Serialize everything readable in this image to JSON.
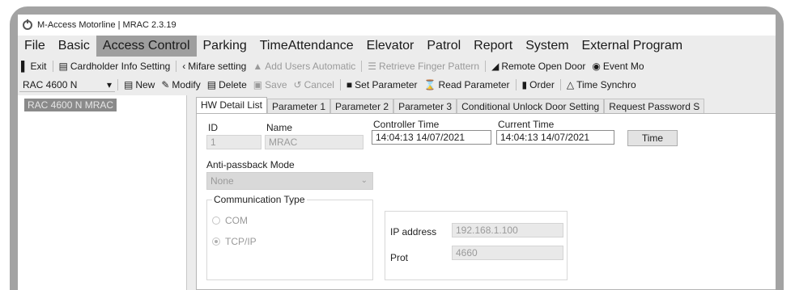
{
  "window": {
    "title": "M-Access Motorline | MRAC 2.3.19"
  },
  "menu": [
    "File",
    "Basic",
    "Access Control",
    "Parking",
    "TimeAttendance",
    "Elevator",
    "Patrol",
    "Report",
    "System",
    "External Program"
  ],
  "menu_active": "Access Control",
  "toolbar1": {
    "exit": "Exit",
    "cardholder": "Cardholder Info Setting",
    "mifare": "Mifare setting",
    "add_users": "Add Users Automatic",
    "retrieve": "Retrieve Finger Pattern",
    "remote_open": "Remote Open Door",
    "event": "Event Mo"
  },
  "toolbar2": {
    "controller_select": "RAC 4600 N",
    "new": "New",
    "modify": "Modify",
    "delete": "Delete",
    "save": "Save",
    "cancel": "Cancel",
    "set_param": "Set Parameter",
    "read_param": "Read Parameter",
    "order": "Order",
    "time_sync": "Time Synchro"
  },
  "tree": {
    "selected": "RAC 4600 N  MRAC"
  },
  "tabs": [
    "HW Detail List",
    "Parameter 1",
    "Parameter 2",
    "Parameter 3",
    "Conditional Unlock Door Setting",
    "Request Password S"
  ],
  "detail": {
    "id_label": "ID",
    "id_value": "1",
    "name_label": "Name",
    "name_value": "MRAC",
    "controller_time_label": "Controller Time",
    "controller_time_value": "14:04:13 14/07/2021",
    "current_time_label": "Current Time",
    "current_time_value": "14:04:13 14/07/2021",
    "time_button": "Time",
    "antipassback_label": "Anti-passback Mode",
    "antipassback_value": "None",
    "comm_title": "Communication Type",
    "com_label": "COM",
    "tcp_label": "TCP/IP",
    "ip_label": "IP address",
    "ip_value": "192.168.1.100",
    "port_label": "Prot",
    "port_value": "4660"
  }
}
